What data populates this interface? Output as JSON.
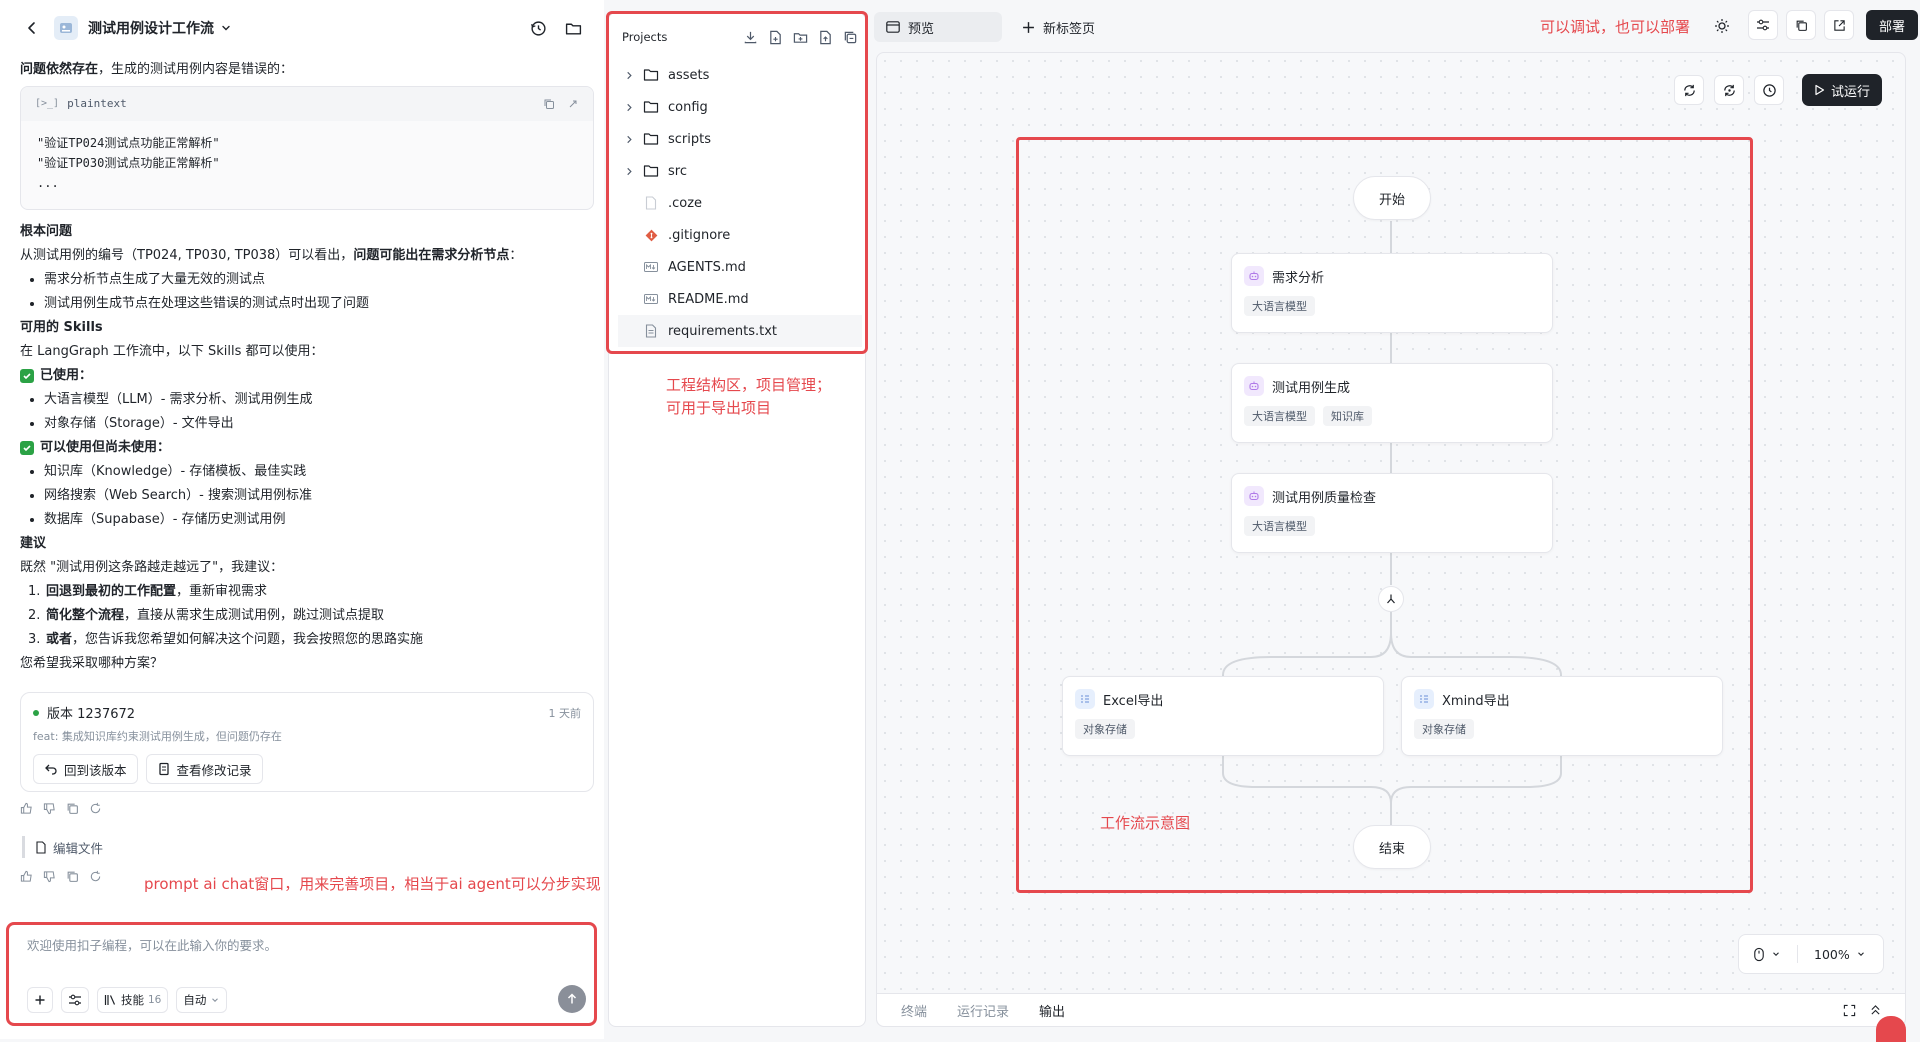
{
  "chat": {
    "project_title": "测试用例设计工作流",
    "message": {
      "intro_bold": "问题依然存在",
      "intro_rest": "，生成的测试用例内容是错误的：",
      "code": {
        "tag": "[>_]",
        "lang": "plaintext",
        "line1": "\"验证TP024测试点功能正常解析\"",
        "line2": "\"验证TP030测试点功能正常解析\"",
        "line3": "..."
      },
      "root_cause_heading": "根本问题",
      "root_cause_text": "从测试用例的编号（TP024, TP030, TP038）可以看出，",
      "root_cause_bold": "问题可能出在需求分析节点",
      "root_cause_end": "：",
      "root_cause_items": [
        "需求分析节点生成了大量无效的测试点",
        "测试用例生成节点在处理这些错误的测试点时出现了问题"
      ],
      "skills_heading": "可用的 Skills",
      "skills_intro": "在 LangGraph 工作流中，以下 Skills 都可以使用：",
      "used_label": "已使用：",
      "used_items": [
        "大语言模型（LLM）- 需求分析、测试用例生成",
        "对象存储（Storage）- 文件导出"
      ],
      "unused_label": "可以使用但尚未使用：",
      "unused_items": [
        "知识库（Knowledge）- 存储模板、最佳实践",
        "网络搜索（Web Search）- 搜索测试用例标准",
        "数据库（Supabase）- 存储历史测试用例"
      ],
      "advice_heading": "建议",
      "advice_intro": "既然 \"测试用例这条路越走越远了\"，我建议：",
      "advice_items": [
        {
          "num": "1.",
          "bold": "回退到最初的工作配置",
          "rest": "，重新审视需求"
        },
        {
          "num": "2.",
          "bold": "简化整个流程",
          "rest": "，直接从需求生成测试用例，跳过测试点提取"
        },
        {
          "num": "3.",
          "bold": "或者",
          "rest": "，您告诉我您希望如何解决这个问题，我会按照您的思路实施"
        }
      ],
      "closing": "您希望我采取哪种方案？"
    },
    "version": {
      "label": "版本 1237672",
      "ago": "1 天前",
      "desc": "feat: 集成知识库约束测试用例生成，但问题仍存在",
      "revert_label": "回到该版本",
      "history_label": "查看修改记录"
    },
    "edit_file_label": "编辑文件",
    "annotation": "prompt ai chat窗口，用来完善项目，相当于ai agent可以分步实现",
    "input": {
      "placeholder": "欢迎使用扣子编程，可以在此输入你的要求。",
      "skills_label": "技能",
      "skills_count": "16",
      "mode_label": "自动"
    }
  },
  "projects": {
    "title": "Projects",
    "items": [
      {
        "name": "assets",
        "type": "folder"
      },
      {
        "name": "config",
        "type": "folder"
      },
      {
        "name": "scripts",
        "type": "folder"
      },
      {
        "name": "src",
        "type": "folder"
      },
      {
        "name": ".coze",
        "type": "file"
      },
      {
        "name": ".gitignore",
        "type": "git"
      },
      {
        "name": "AGENTS.md",
        "type": "md"
      },
      {
        "name": "README.md",
        "type": "md"
      },
      {
        "name": "requirements.txt",
        "type": "txt"
      }
    ],
    "annotation_line1": "工程结构区，项目管理；",
    "annotation_line2": "可用于导出项目"
  },
  "tabs": {
    "preview_label": "预览",
    "new_tab_label": "新标签页"
  },
  "top_annotation": "可以调试，也可以部署",
  "deploy_label": "部署",
  "canvas": {
    "run_label": "试运行",
    "start_label": "开始",
    "end_label": "结束",
    "nodes": [
      {
        "title": "需求分析",
        "tags": [
          "大语言模型"
        ]
      },
      {
        "title": "测试用例生成",
        "tags": [
          "大语言模型",
          "知识库"
        ]
      },
      {
        "title": "测试用例质量检查",
        "tags": [
          "大语言模型"
        ]
      }
    ],
    "branches": [
      {
        "title": "Excel导出",
        "tags": [
          "对象存储"
        ]
      },
      {
        "title": "Xmind导出",
        "tags": [
          "对象存储"
        ]
      }
    ],
    "annotation": "工作流示意图",
    "zoom_label": "100%"
  },
  "bottom_tabs": [
    "终端",
    "运行记录",
    "输出"
  ],
  "colors": {
    "annotation_red": "#e5484d",
    "dark_button": "#1f2329",
    "success_green": "#2ba245"
  }
}
